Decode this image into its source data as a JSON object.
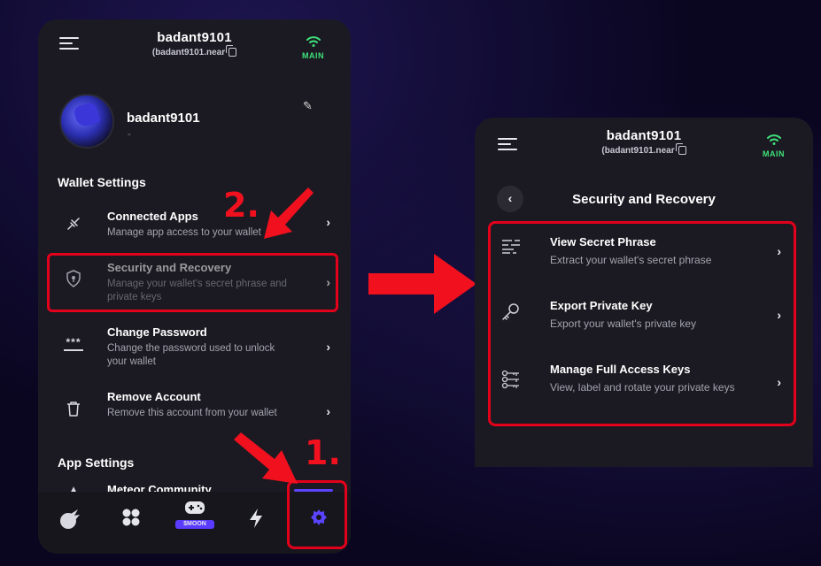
{
  "account": {
    "name": "badant9101",
    "address": "(badant9101.near",
    "network": "MAIN"
  },
  "profile": {
    "name": "badant9101",
    "subtitle": "-"
  },
  "wallet_settings": {
    "heading": "Wallet Settings",
    "items": [
      {
        "title": "Connected Apps",
        "desc": "Manage app access to your wallet"
      },
      {
        "title": "Security and Recovery",
        "desc": "Manage your wallet's secret phrase and private keys"
      },
      {
        "title": "Change Password",
        "desc": "Change the password used to unlock your wallet"
      },
      {
        "title": "Remove Account",
        "desc": "Remove this account from your wallet"
      }
    ]
  },
  "app_settings": {
    "heading": "App Settings",
    "first_item": "Meteor Community"
  },
  "tabs": {
    "moon_badge": "$MOON"
  },
  "annotations": {
    "step1": "1.",
    "step2": "2."
  },
  "security": {
    "title": "Security and Recovery",
    "items": [
      {
        "title": "View Secret Phrase",
        "desc": "Extract your wallet's secret phrase"
      },
      {
        "title": "Export Private Key",
        "desc": "Export your wallet's private key"
      },
      {
        "title": "Manage Full Access Keys",
        "desc": "View, label and rotate your private keys"
      }
    ]
  },
  "colors": {
    "panel": "#1b1a22",
    "network": "#3fe07a",
    "accent": "#5a44ff",
    "annotation": "#e3001b"
  }
}
